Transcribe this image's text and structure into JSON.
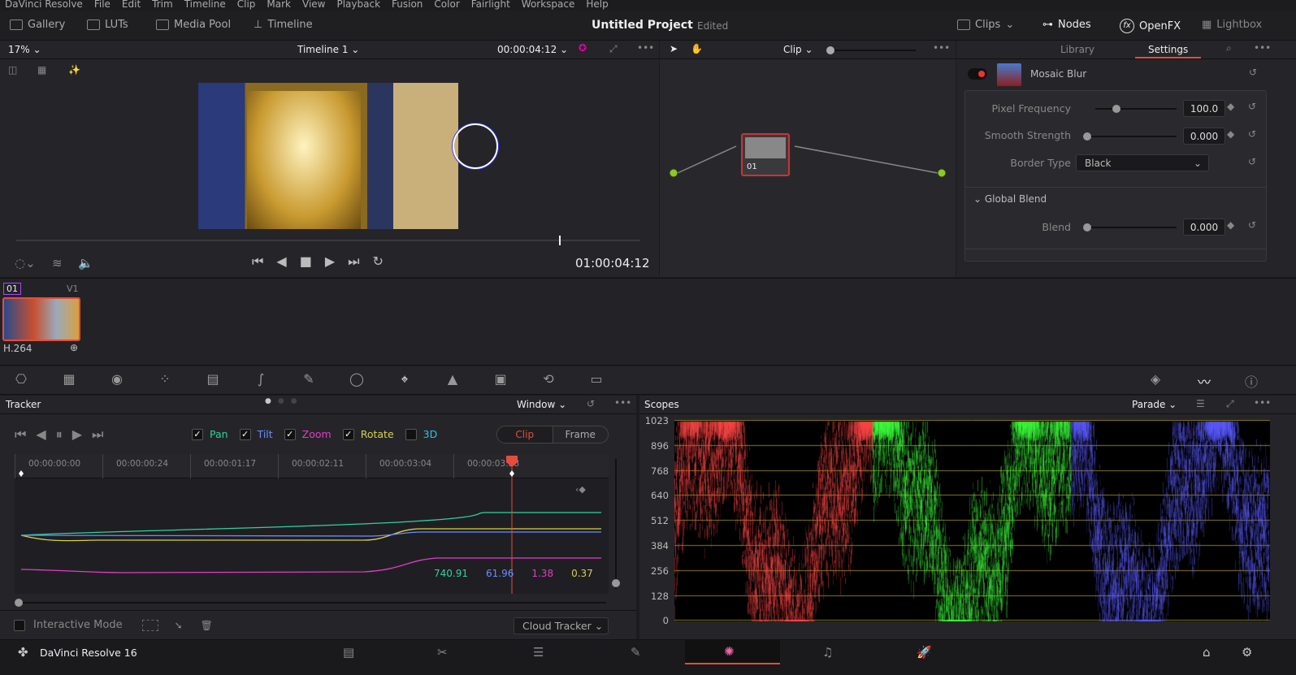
{
  "menu": [
    "DaVinci Resolve",
    "File",
    "Edit",
    "Trim",
    "Timeline",
    "Clip",
    "Mark",
    "View",
    "Playback",
    "Fusion",
    "Color",
    "Fairlight",
    "Workspace",
    "Help"
  ],
  "toolbar": {
    "gallery": "Gallery",
    "luts": "LUTs",
    "media_pool": "Media Pool",
    "timeline": "Timeline",
    "project_title": "Untitled Project",
    "project_status": "Edited",
    "clips": "Clips",
    "nodes": "Nodes",
    "openfx": "OpenFX",
    "lightbox": "Lightbox"
  },
  "viewer": {
    "zoom": "17%",
    "timeline_name": "Timeline 1",
    "timecode_top": "00:00:04:12",
    "timecode": "01:00:04:12",
    "scrub_position": 0.87
  },
  "nodes": {
    "mode": "Clip",
    "node_label": "01"
  },
  "inspector": {
    "tabs": [
      "Library",
      "Settings"
    ],
    "active_tab": "Settings",
    "effect_name": "Mosaic Blur",
    "params": [
      {
        "label": "Pixel Frequency",
        "value": "100.0",
        "slider": 0.25
      },
      {
        "label": "Smooth Strength",
        "value": "0.000",
        "slider": 0
      },
      {
        "label": "Border Type",
        "value": "Black"
      }
    ],
    "global_blend": {
      "title": "Global Blend",
      "label": "Blend",
      "value": "0.000",
      "slider": 0
    }
  },
  "clips": {
    "index": "01",
    "track": "V1",
    "codec": "H.264"
  },
  "tracker": {
    "title": "Tracker",
    "mode": "Window",
    "checks": [
      {
        "label": "Pan",
        "checked": true,
        "color": "#2fd39a"
      },
      {
        "label": "Tilt",
        "checked": true,
        "color": "#6a8cff"
      },
      {
        "label": "Zoom",
        "checked": true,
        "color": "#e23cc8"
      },
      {
        "label": "Rotate",
        "checked": true,
        "color": "#d8cf4a"
      },
      {
        "label": "3D",
        "checked": false,
        "color": "#2ac4e8"
      }
    ],
    "clip_toggle": "Clip",
    "frame_toggle": "Frame",
    "active_toggle": "Clip",
    "ruler": [
      "00:00:00:00",
      "00:00:00:24",
      "00:00:01:17",
      "00:00:02:11",
      "00:00:03:04",
      "00:00:03:28"
    ],
    "values": [
      {
        "v": "740.91",
        "color": "#2fd39a"
      },
      {
        "v": "61.96",
        "color": "#6a8cff"
      },
      {
        "v": "1.38",
        "color": "#e23cc8"
      },
      {
        "v": "0.37",
        "color": "#d8cf4a"
      }
    ],
    "interactive_mode": "Interactive Mode",
    "cloud_tracker": "Cloud Tracker"
  },
  "scopes": {
    "title": "Scopes",
    "mode": "Parade",
    "scale": [
      "1023",
      "896",
      "768",
      "640",
      "512",
      "384",
      "256",
      "128",
      "0"
    ]
  },
  "footer": {
    "app": "DaVinci Resolve 16"
  },
  "colors": {
    "accent": "#e64b3c",
    "bg": "#1c1c1f",
    "panel": "#252529"
  }
}
